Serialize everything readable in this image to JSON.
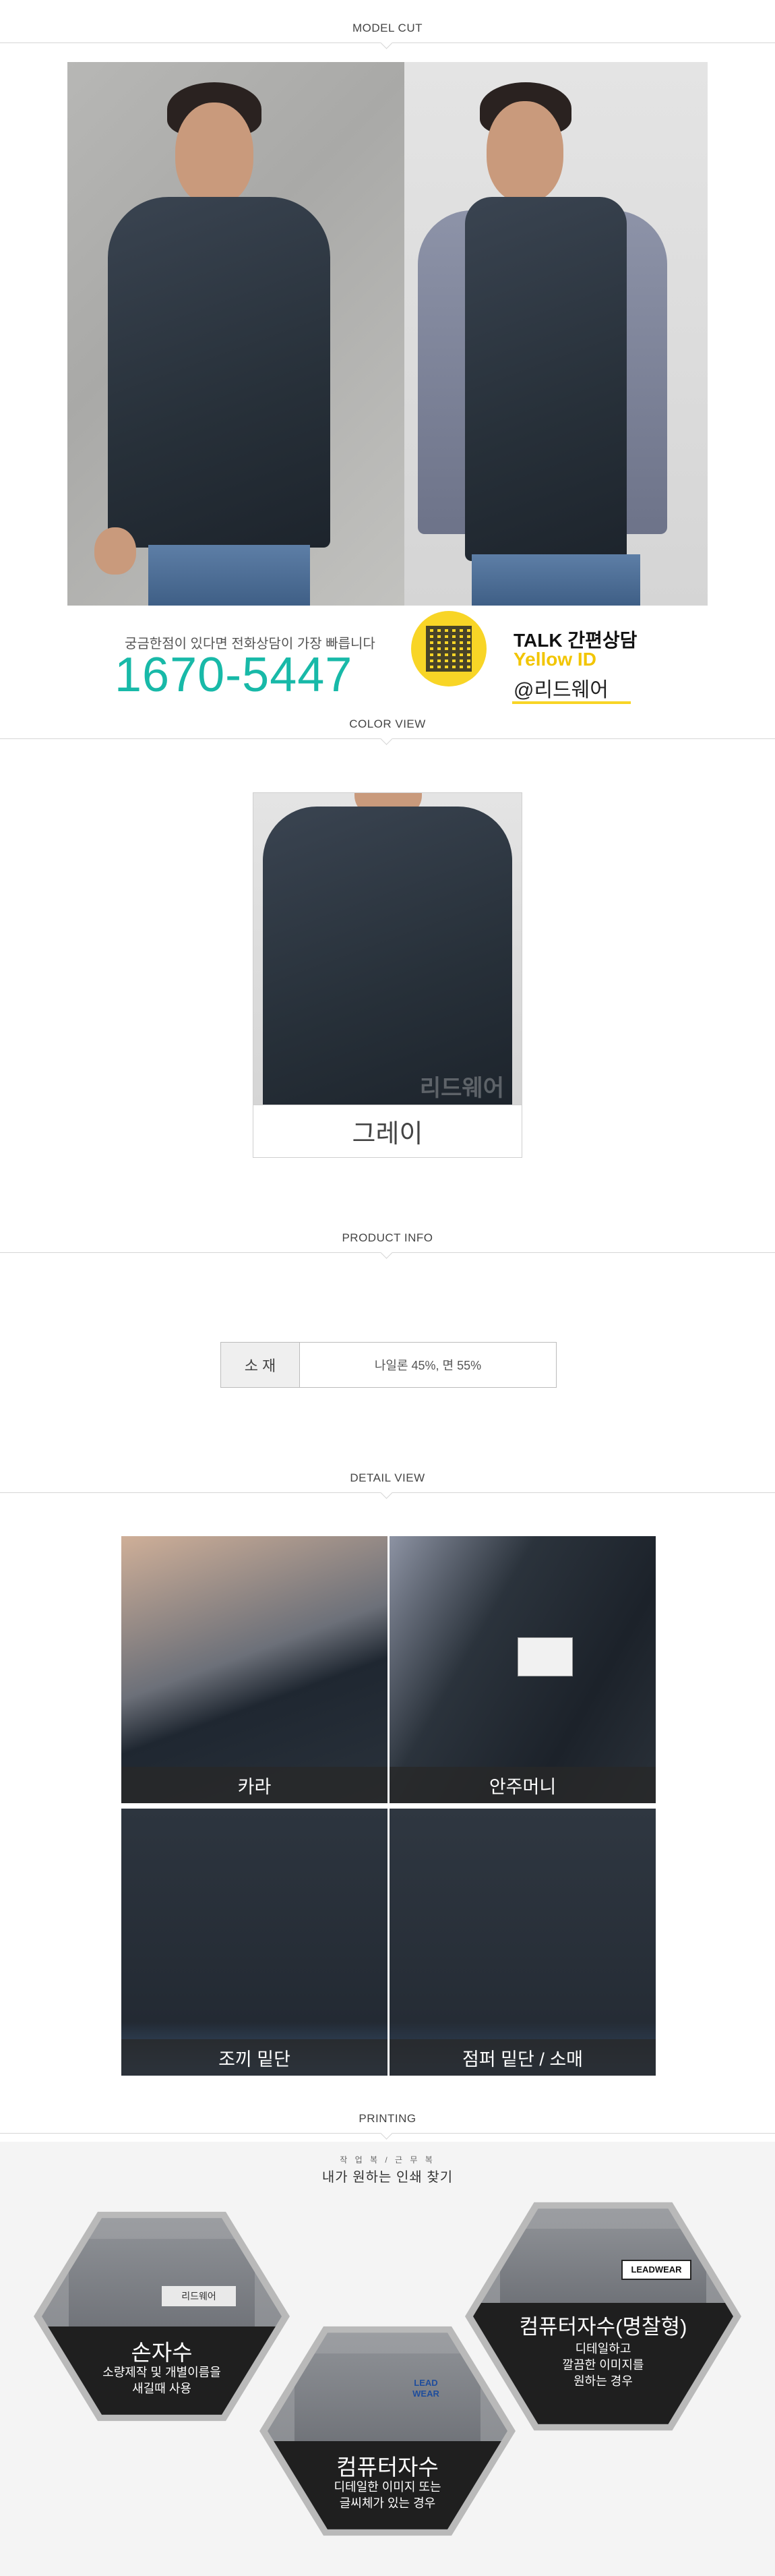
{
  "sections": {
    "model_cut": "MODEL CUT",
    "color_view": "COLOR VIEW",
    "product_info": "PRODUCT INFO",
    "detail_view": "DETAIL VIEW",
    "printing": "PRINTING"
  },
  "contact": {
    "note": "궁금한점이 있다면 전화상담이 가장 빠릅니다",
    "phone": "1670-5447",
    "talk_label": "TALK",
    "talk_title": "간편상담",
    "yellow_id": "Yellow ID",
    "kakao_id": "@리드웨어"
  },
  "color_view": {
    "watermark": "리드웨어",
    "color_name": "그레이"
  },
  "product_info": {
    "material_label": "소 재",
    "material_value": "나일론 45%, 면 55%"
  },
  "detail_view": {
    "tiles": [
      {
        "caption": "카라"
      },
      {
        "caption": "안주머니"
      },
      {
        "caption": "조끼 밑단"
      },
      {
        "caption": "점퍼 밑단 / 소매"
      }
    ]
  },
  "printing": {
    "subtitle_small": "작 업 복 / 근 무 복",
    "subtitle": "내가 원하는 인쇄 찾기",
    "options": [
      {
        "title": "손자수",
        "desc1": "소량제작 및 개별이름을",
        "desc2": "새길때 사용",
        "patch": "리드웨어"
      },
      {
        "title": "컴퓨터자수",
        "desc1": "디테일한 이미지 또는",
        "desc2": "글씨체가 있는 경우",
        "patch": "LEAD WEAR"
      },
      {
        "title": "컴퓨터자수(명찰형)",
        "desc1": "디테일하고",
        "desc2": "깔끔한 이미지를",
        "desc3": "원하는 경우",
        "patch": "LEADWEAR"
      }
    ]
  },
  "colors": {
    "phone": "#18b9a8",
    "kakao_yellow": "#f8d526",
    "navy": "#273039"
  }
}
